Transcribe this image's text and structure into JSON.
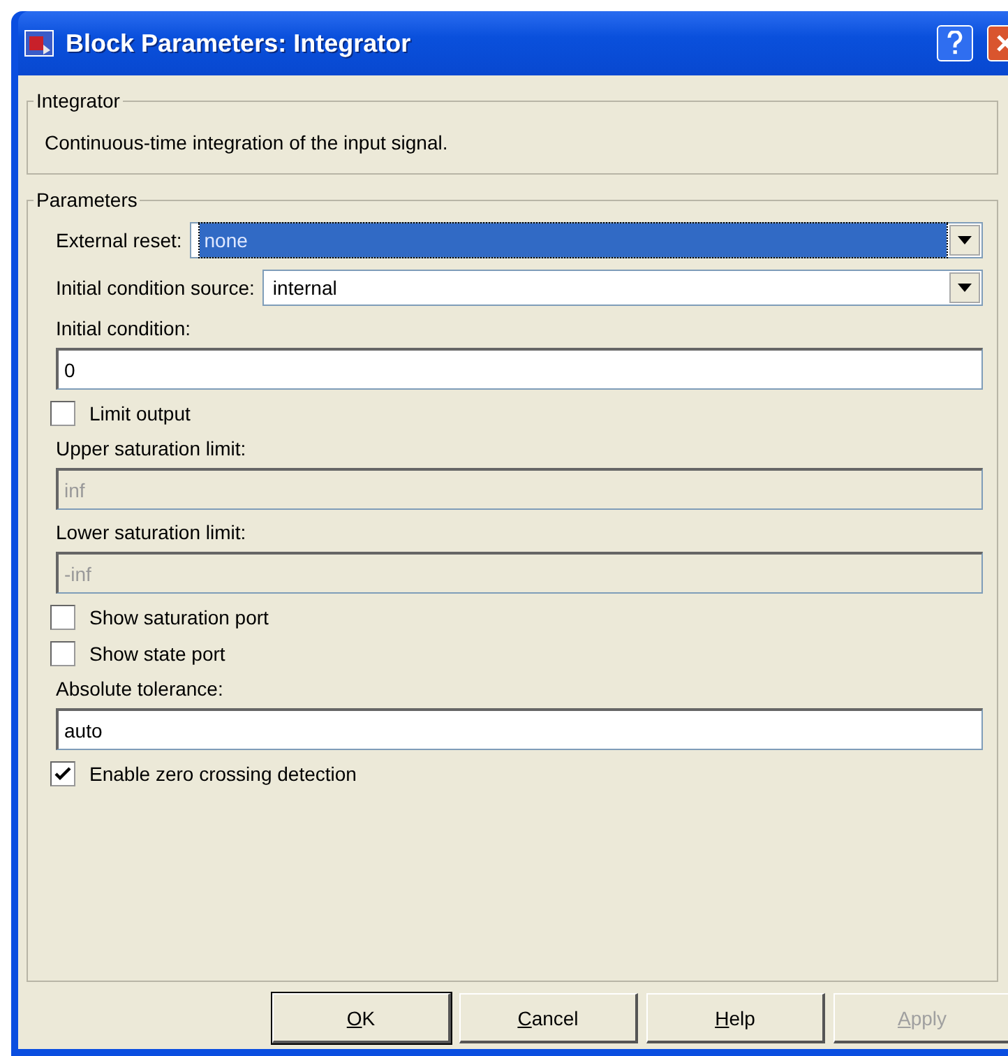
{
  "window": {
    "title": "Block Parameters: Integrator"
  },
  "description_group": {
    "title": "Integrator",
    "text": "Continuous-time integration of the input signal."
  },
  "parameters_group": {
    "title": "Parameters",
    "items": [
      {
        "kind": "dropdown",
        "label": "External reset:",
        "value": "none",
        "focused": true
      },
      {
        "kind": "dropdown",
        "label": "Initial condition source:",
        "value": "internal",
        "focused": false
      },
      {
        "kind": "field",
        "label": "Initial condition:",
        "value": "0",
        "disabled": false
      },
      {
        "kind": "checkbox",
        "label": "Limit output",
        "checked": false
      },
      {
        "kind": "field",
        "label": "Upper saturation limit:",
        "value": "inf",
        "disabled": true
      },
      {
        "kind": "field",
        "label": "Lower saturation limit:",
        "value": "-inf",
        "disabled": true
      },
      {
        "kind": "checkbox",
        "label": "Show saturation port",
        "checked": false
      },
      {
        "kind": "checkbox",
        "label": "Show state port",
        "checked": false
      },
      {
        "kind": "field",
        "label": "Absolute tolerance:",
        "value": "auto",
        "disabled": false
      },
      {
        "kind": "checkbox",
        "label": "Enable zero crossing detection",
        "checked": true
      }
    ]
  },
  "buttons": [
    {
      "label": "OK",
      "disabled": false,
      "default": true
    },
    {
      "label": "Cancel",
      "disabled": false,
      "default": false
    },
    {
      "label": "Help",
      "disabled": false,
      "default": false
    },
    {
      "label": "Apply",
      "disabled": true,
      "default": false
    }
  ]
}
